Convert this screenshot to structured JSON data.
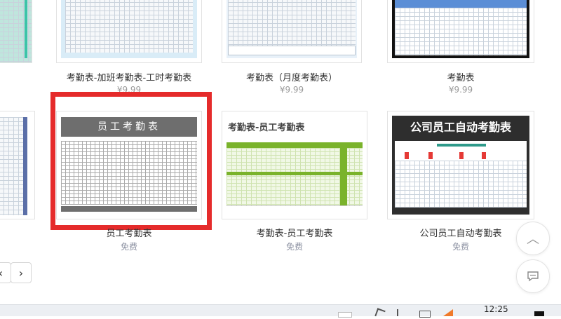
{
  "row1": [
    {
      "title": "考勤表-加班考勤表-工时考勤表",
      "price": "¥9.99"
    },
    {
      "title": "考勤表（月度考勤表）",
      "price": "¥9.99"
    },
    {
      "title": "考勤表",
      "price": "¥9.99"
    }
  ],
  "row2": [
    {
      "title": "员工考勤表",
      "price": "免费",
      "thumb_title": "员工考勤表"
    },
    {
      "title": "考勤表-员工考勤表",
      "price": "免费",
      "thumb_title": "考勤表-员工考勤表"
    },
    {
      "title": "公司员工自动考勤表",
      "price": "免费",
      "thumb_title": "公司员工自动考勤表"
    }
  ],
  "pagination": {
    "prev_icon": "‹",
    "next_icon": "›"
  },
  "floating": {
    "top_icon": "︿"
  },
  "taskbar": {
    "time": "12:25"
  },
  "colors": {
    "highlight": "#e52b2b",
    "green": "#7ab32b",
    "gray_header": "#6e6e6e"
  }
}
